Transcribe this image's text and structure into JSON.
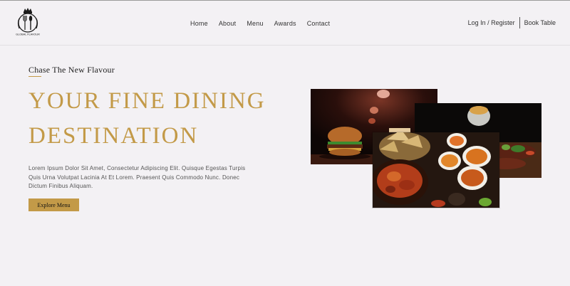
{
  "brand": {
    "logo_text": "GLOBAL FLAVOUR",
    "logo_icon": "crown-fork-spoon-icon"
  },
  "nav": {
    "items": [
      "Home",
      "About",
      "Menu",
      "Awards",
      "Contact"
    ]
  },
  "account": {
    "login_label": "Log In / Register",
    "book_label": "Book Table"
  },
  "hero": {
    "eyebrow": "Chase The New Flavour",
    "title_line1": "YOUR FINE DINING",
    "title_line2": "DESTINATION",
    "description": "Lorem Ipsum Dolor Sit Amet, Consectetur Adipiscing Elit. Quisque Egestas Turpis Quis Urna Volutpat Lacinia At Et Lorem. Praesent Quis Commodo Nunc. Donec Dictum Finibus Aliquam.",
    "cta_label": "Explore Menu"
  },
  "colors": {
    "accent": "#c39a48",
    "background": "#f3f1f4",
    "text": "#333333"
  }
}
